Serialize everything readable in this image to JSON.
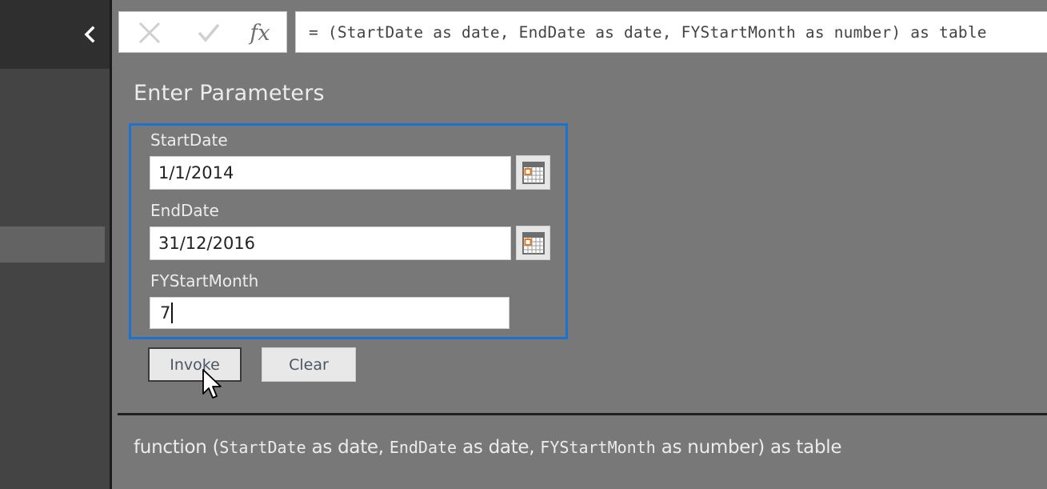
{
  "sidebar": {
    "collapse_icon": "chevron-left-icon",
    "selected_item_label": ""
  },
  "formula_bar": {
    "cancel_icon": "close-icon",
    "commit_icon": "checkmark-icon",
    "fx_label": "fx",
    "formula": "= (StartDate as date, EndDate as date, FYStartMonth as number) as table"
  },
  "main": {
    "title": "Enter Parameters",
    "parameters": [
      {
        "label": "StartDate",
        "value": "1/1/2014",
        "has_calendar": true,
        "calendar_icon": "calendar-icon"
      },
      {
        "label": "EndDate",
        "value": "31/12/2016",
        "has_calendar": true,
        "calendar_icon": "calendar-icon"
      },
      {
        "label": "FYStartMonth",
        "value": "7",
        "has_calendar": false
      }
    ],
    "buttons": {
      "invoke": "Invoke",
      "clear": "Clear"
    },
    "signature": {
      "prefix": "function (",
      "p1_name": "StartDate",
      "p1_type": " as date, ",
      "p2_name": "EndDate",
      "p2_type": " as date, ",
      "p3_name": "FYStartMonth",
      "p3_type": " as number) as table"
    }
  },
  "colors": {
    "focus_border": "#1a73d1",
    "calendar_accent": "#e07b24",
    "background": "#787878",
    "sidebar": "#444444"
  }
}
